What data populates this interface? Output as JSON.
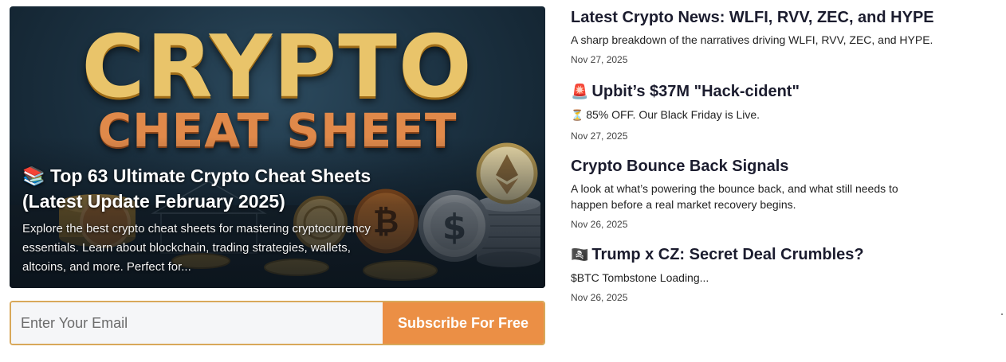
{
  "feature": {
    "hero_line1": "CRYPTO",
    "hero_line2": "CHEAT SHEET",
    "title_emoji": "📚",
    "title": "Top 63 Ultimate Crypto Cheat Sheets (Latest Update February 2025)",
    "description": "Explore the best crypto cheat sheets for mastering cryptocurrency essentials. Learn about blockchain, trading strategies, wallets, altcoins, and more. Perfect for..."
  },
  "subscribe": {
    "placeholder": "Enter Your Email",
    "button_label": "Subscribe For Free",
    "accent": "#eb8f45"
  },
  "news": [
    {
      "title_emoji": "",
      "title": "Latest Crypto News: WLFI, RVV, ZEC, and HYPE",
      "summary_emoji": "",
      "summary": "A sharp breakdown of the narratives driving WLFI, RVV, ZEC, and HYPE.",
      "date": "Nov 27, 2025"
    },
    {
      "title_emoji": "🚨",
      "title": "Upbit’s $37M \"Hack-cident\"",
      "summary_emoji": "⏳",
      "summary": "85% OFF. Our Black Friday is Live.",
      "date": "Nov 27, 2025"
    },
    {
      "title_emoji": "",
      "title": "Crypto Bounce Back Signals",
      "summary_emoji": "",
      "summary": "A look at what’s powering the bounce back, and what still needs to happen before a real market recovery begins.",
      "date": "Nov 26, 2025"
    },
    {
      "title_emoji": "🏴‍☠️",
      "title": "Trump x CZ: Secret Deal Crumbles?",
      "summary_emoji": "",
      "summary": "$BTC Tombstone Loading...",
      "date": "Nov 26, 2025"
    }
  ]
}
